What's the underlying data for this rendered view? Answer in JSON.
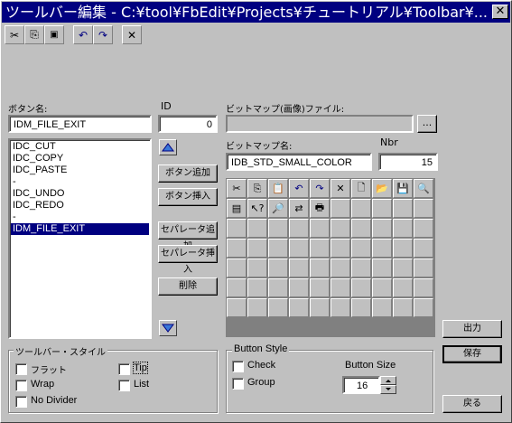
{
  "window": {
    "title": "ツールバー編集 - C:¥tool¥FbEdit¥Projects¥チュートリアル¥Toolbar¥...",
    "close": "✕"
  },
  "toolbar": {
    "buttons": [
      {
        "name": "cut-icon",
        "glyph": "✂"
      },
      {
        "name": "copy-icon",
        "glyph": "⎘"
      },
      {
        "name": "paste-icon",
        "glyph": "📋"
      },
      {
        "name": "undo-icon",
        "glyph": "↶"
      },
      {
        "name": "redo-icon",
        "glyph": "↷"
      },
      {
        "name": "delete-icon",
        "glyph": "✕"
      }
    ]
  },
  "button_name": {
    "label": "ボタン名:",
    "value": "IDM_FILE_EXIT"
  },
  "id": {
    "label": "ID",
    "value": "0"
  },
  "list": {
    "items": [
      "IDC_CUT",
      "IDC_COPY",
      "IDC_PASTE",
      "-",
      "IDC_UNDO",
      "IDC_REDO",
      "-",
      "IDM_FILE_EXIT"
    ],
    "selected_index": 7
  },
  "actions": {
    "add_button": "ボタン追加",
    "insert_button": "ボタン挿入",
    "add_separator": "セパレータ追加",
    "insert_separator": "セパレータ挿入",
    "delete": "削除"
  },
  "bitmap_file": {
    "label": "ビットマップ(画像)ファイル:",
    "value": "",
    "browse": "..."
  },
  "bitmap_name": {
    "label": "ビットマップ名:",
    "value": "IDB_STD_SMALL_COLOR"
  },
  "nbr": {
    "label": "Nbr",
    "value": "15"
  },
  "bitmap_grid": {
    "rows": 7,
    "cols": 10,
    "icons": [
      "cut-icon",
      "copy-icon",
      "paste-icon",
      "undo-icon",
      "redo-icon",
      "delete-icon",
      "new-file-icon",
      "open-folder-icon",
      "save-icon",
      "print-preview-icon",
      "properties-icon",
      "help-icon",
      "find-icon",
      "replace-icon",
      "print-icon"
    ],
    "glyphs": [
      "✂",
      "⎘",
      "📋",
      "↶",
      "↷",
      "✕",
      "🗋",
      "📂",
      "💾",
      "🔍",
      "▤",
      "↖?",
      "🔎",
      "⇄",
      "🖶"
    ]
  },
  "toolbar_style": {
    "title": "ツールバー・スタイル",
    "flat": "フラット",
    "wrap": "Wrap",
    "no_divider": "No Divider",
    "tip": "Tip",
    "list": "List"
  },
  "button_style": {
    "title": "Button Style",
    "check": "Check",
    "group": "Group",
    "size_label": "Button Size",
    "size_value": "16"
  },
  "footer": {
    "output": "出力",
    "save": "保存",
    "back": "戻る"
  }
}
